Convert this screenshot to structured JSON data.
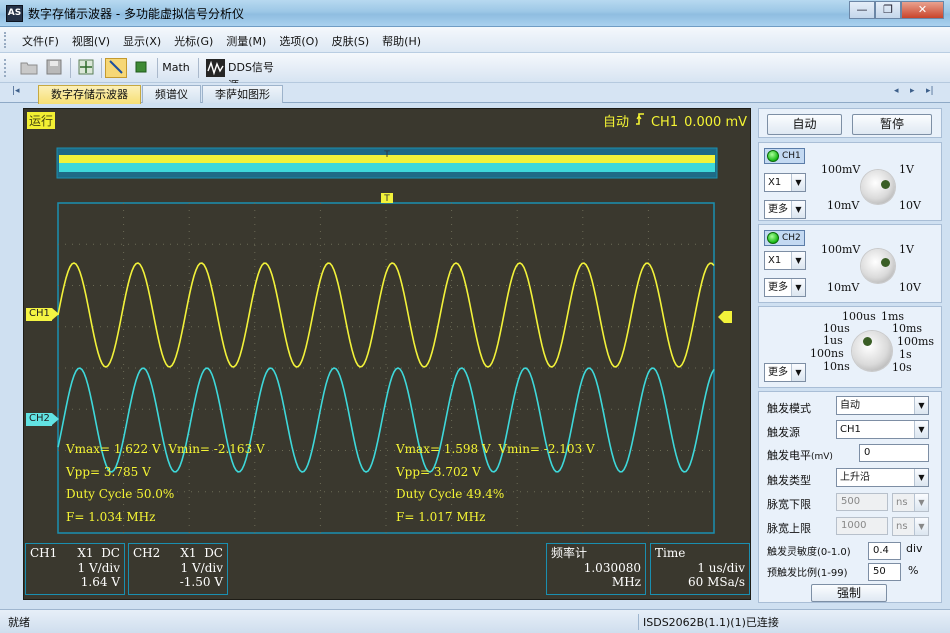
{
  "window": {
    "icon_text": "AS",
    "title": "数字存储示波器 - 多功能虚拟信号分析仪",
    "buttons": [
      "—",
      "❐",
      "✕"
    ]
  },
  "menu": [
    "文件(F)",
    "视图(V)",
    "显示(X)",
    "光标(G)",
    "测量(M)",
    "选项(O)",
    "皮肤(S)",
    "帮助(H)"
  ],
  "toolbar": {
    "math_label": "Math",
    "dds_label": "DDS信号源"
  },
  "tabs": [
    "数字存储示波器",
    "频谱仪",
    "李萨如图形"
  ],
  "scope": {
    "status": "运行",
    "trigger_mode": "自动",
    "trigger_channel": "CH1",
    "trigger_level": "0.000 mV",
    "trigger_marker": "T",
    "ch1_marker": "CH1",
    "ch2_marker": "CH2",
    "colors": {
      "ch1": "#f2f23a",
      "ch2": "#3ed8da",
      "background": "#3a382e",
      "grid": "#1a8fb0"
    },
    "ch1_meas": {
      "vmax": "Vmax= 1.622 V",
      "vmin": "Vmin= -2.163 V",
      "vpp": "Vpp= 3.785 V",
      "duty": "Duty Cycle 50.0%",
      "freq": "F= 1.034 MHz"
    },
    "ch2_meas": {
      "vmax": "Vmax= 1.598 V",
      "vmin": "Vmin= -2.103 V",
      "vpp": "Vpp= 3.702 V",
      "duty": "Duty Cycle 49.4%",
      "freq": "F= 1.017 MHz"
    },
    "info": {
      "ch1": {
        "name": "CH1",
        "probe": "X1",
        "coupling": "DC",
        "scale": "1 V/div",
        "offset": "1.64 V"
      },
      "ch2": {
        "name": "CH2",
        "probe": "X1",
        "coupling": "DC",
        "scale": "1 V/div",
        "offset": "-1.50 V"
      },
      "counter": {
        "label": "频率计",
        "value": "1.030080 MHz"
      },
      "time": {
        "label": "Time",
        "scale": "1 us/div",
        "rate": "60 MSa/s"
      }
    }
  },
  "side": {
    "auto_button": "自动",
    "pause_button": "暂停",
    "ch1": {
      "label": "CH1",
      "probe": "X1",
      "more": "更多",
      "labels": [
        "100mV",
        "1V",
        "10mV",
        "10V"
      ]
    },
    "ch2": {
      "label": "CH2",
      "probe": "X1",
      "more": "更多",
      "labels": [
        "100mV",
        "1V",
        "10mV",
        "10V"
      ]
    },
    "timebase": {
      "more": "更多",
      "labels": [
        "100us",
        "1ms",
        "10us",
        "10ms",
        "1us",
        "100ms",
        "100ns",
        "1s",
        "10ns",
        "10s"
      ]
    },
    "trigger": {
      "mode_label": "触发模式",
      "mode_value": "自动",
      "source_label": "触发源",
      "source_value": "CH1",
      "level_label": "触发电平",
      "level_unit": "(mV)",
      "level_value": "0",
      "type_label": "触发类型",
      "type_value": "上升沿",
      "pw_low_label": "脉宽下限",
      "pw_low_value": "500",
      "pw_low_unit": "ns",
      "pw_high_label": "脉宽上限",
      "pw_high_value": "1000",
      "pw_high_unit": "ns",
      "sens_label": "触发灵敏度(0-1.0)",
      "sens_value": "0.4",
      "sens_unit": "div",
      "pre_label": "预触发比例(1-99)",
      "pre_value": "50",
      "pre_unit": "%",
      "force_button": "强制"
    }
  },
  "status": {
    "left": "就绪",
    "right": "ISDS2062B(1.1)(1)已连接"
  }
}
